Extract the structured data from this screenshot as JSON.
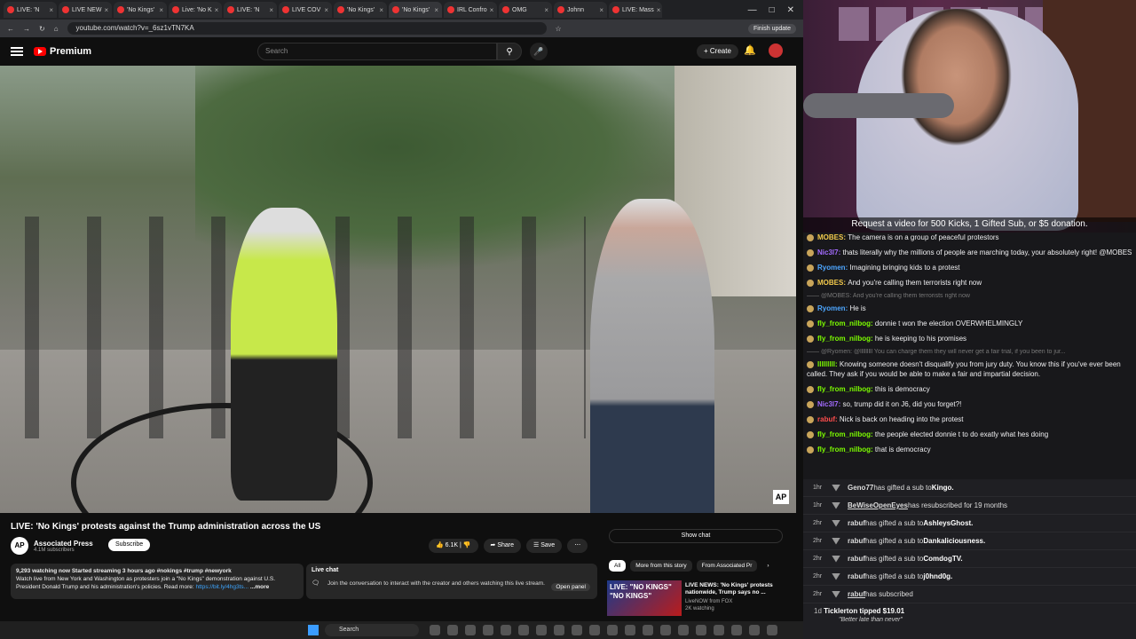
{
  "browser": {
    "tabs": [
      "LIVE: 'N",
      "LIVE NEW",
      "'No Kings'",
      "Live: 'No K",
      "LIVE: 'N",
      "LIVE COV",
      "'No Kings'",
      "'No Kings'",
      "IRL Confro",
      "OMG",
      "Johnn",
      "LIVE: Mass"
    ],
    "url": "youtube.com/watch?v=_6sz1vTN7KA",
    "update": "Finish update"
  },
  "youtube": {
    "brand": "Premium",
    "search_placeholder": "Search",
    "create": "Create"
  },
  "video": {
    "watermark": "AP",
    "title": "LIVE: 'No Kings' protests against the Trump administration across the US",
    "channel": "Associated Press",
    "subs": "4.1M subscribers",
    "subscribe": "Subscribe",
    "likes": "6.1K",
    "share": "Share",
    "save": "Save",
    "meta": "9,293 watching now  Started streaming 3 hours ago  #nokings #trump #newyork",
    "desc": "Watch live from New York and Washington as protesters join a \"No Kings\" demonstration against U.S. President Donald Trump and his administration's policies. Read more: ",
    "link": "https://bit.ly/4hg3ts...",
    "more": "...more"
  },
  "livechat": {
    "heading": "Live chat",
    "text": "Join the conversation to interact with the creator and others watching this live stream.",
    "open": "Open panel"
  },
  "sidebar": {
    "show_chat": "Show chat",
    "chips": [
      "All",
      "More from this story",
      "From Associated Pr"
    ],
    "rec": {
      "thumb": "LIVE: \"NO KINGS\" \"NO KINGS\"",
      "title": "LIVE NEWS: 'No Kings' protests nationwide, Trump says no ...",
      "ch": "LiveNOW from FOX",
      "views": "2K watching"
    }
  },
  "taskbar": {
    "search": "Search"
  },
  "stream": {
    "banner": "Request a video for 500 Kicks, 1 Gifted Sub, or $5 donation."
  },
  "chat": [
    {
      "type": "msg",
      "user": "MOBES:",
      "text": "The camera is on a group of peaceful protestors",
      "color": "#f2c94c"
    },
    {
      "type": "msg",
      "user": "Nic3l7:",
      "text": "thats literally why the millions of people are marching today, your absolutely right! @MOBES",
      "color": "#a36bff"
    },
    {
      "type": "msg",
      "user": "Ryomen:",
      "text": "Imagining bringing kids to a protest",
      "color": "#4da6ff"
    },
    {
      "type": "msg",
      "user": "MOBES:",
      "text": "And you're calling them terrorists right now",
      "color": "#f2c94c"
    },
    {
      "type": "reply",
      "text": "@MOBES: And you're calling them terrorists right now"
    },
    {
      "type": "msg",
      "user": "Ryomen:",
      "text": "He is",
      "color": "#4da6ff"
    },
    {
      "type": "msg",
      "user": "fly_from_nilbog:",
      "text": "donnie t won the election OVERWHELMINGLY",
      "color": "#7cfc00"
    },
    {
      "type": "msg",
      "user": "fly_from_nilbog:",
      "text": "he is keeping to his promises",
      "color": "#7cfc00"
    },
    {
      "type": "reply",
      "text": "@Ryomen: @lllllllll You can charge them they will never get a fair trial, if you been to jur..."
    },
    {
      "type": "msg",
      "user": "lllllllll:",
      "text": "Knowing someone doesn't disqualify you from jury duty. You know this if you've ever been called. They ask if you would be able to make a fair and impartial decision.",
      "color": "#7cfc00"
    },
    {
      "type": "msg",
      "user": "fly_from_nilbog:",
      "text": "this is democracy",
      "color": "#7cfc00"
    },
    {
      "type": "msg",
      "user": "Nic3l7:",
      "text": "so, trump did it on J6, did you forget?!",
      "color": "#a36bff"
    },
    {
      "type": "msg",
      "user": "rabuf:",
      "text": "Nick is back on heading into the protest",
      "color": "#ff4d4d"
    },
    {
      "type": "msg",
      "user": "fly_from_nilbog:",
      "text": "the people elected donnie t to do exatly what hes doing",
      "color": "#7cfc00"
    },
    {
      "type": "msg",
      "user": "fly_from_nilbog:",
      "text": "that is democracy",
      "color": "#7cfc00"
    }
  ],
  "events": [
    {
      "time": "1hr",
      "user": "Geno77",
      "text": " has gifted a sub to ",
      "target": "Kingo.",
      "u": false
    },
    {
      "time": "1hr",
      "user": "BeWiseOpenEyes",
      "text": " has resubscribed for 19 months",
      "target": "",
      "u": true
    },
    {
      "time": "2hr",
      "user": "rabuf",
      "text": " has gifted a sub to ",
      "target": "AshleysGhost.",
      "u": false
    },
    {
      "time": "2hr",
      "user": "rabuf",
      "text": " has gifted a sub to ",
      "target": "Dankaliciousness.",
      "u": false
    },
    {
      "time": "2hr",
      "user": "rabuf",
      "text": " has gifted a sub to ",
      "target": "ComdogTV.",
      "u": false
    },
    {
      "time": "2hr",
      "user": "rabuf",
      "text": " has gifted a sub to ",
      "target": "j0hnd0g.",
      "u": false
    },
    {
      "time": "2hr",
      "user": "rabuf",
      "text": " has subscribed",
      "target": "",
      "u": true
    }
  ],
  "tip": {
    "time": "1d",
    "text": "Ticklerton tipped $19.01",
    "quote": "\"Better late than never\""
  }
}
